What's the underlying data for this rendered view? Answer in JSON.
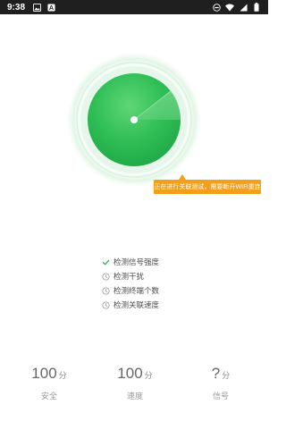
{
  "status_bar": {
    "time": "9:38",
    "left_icons": [
      "image-icon",
      "text-icon"
    ],
    "right_icons": [
      "do-not-disturb-icon",
      "wifi-icon",
      "signal-icon",
      "battery-icon"
    ]
  },
  "tooltip": {
    "text": "正在进行关联测试，需要断开WiFi重连"
  },
  "checklist": {
    "items": [
      {
        "label": "检测信号强度",
        "status": "done"
      },
      {
        "label": "检测干扰",
        "status": "pending"
      },
      {
        "label": "检测终端个数",
        "status": "pending"
      },
      {
        "label": "检测关联速度",
        "status": "pending"
      }
    ]
  },
  "stats": [
    {
      "value": "100",
      "unit": "分",
      "label": "安全"
    },
    {
      "value": "100",
      "unit": "分",
      "label": "速度"
    },
    {
      "value": "?",
      "unit": "分",
      "label": "信号"
    }
  ],
  "colors": {
    "radar_green": "#22b04c",
    "radar_green_light": "#63d779",
    "tooltip_orange": "#f29f1a",
    "check_green": "#2db34a",
    "pending_gray": "#9a9a9a",
    "status_bar_bg": "#1f1f1f"
  }
}
